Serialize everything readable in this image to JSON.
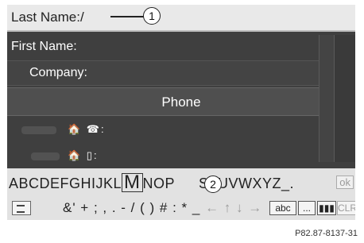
{
  "form": {
    "last_name_label": "Last Name:",
    "last_name_value": "/",
    "first_name_label": "First Name:",
    "company_label": "Company:",
    "phone_header": "Phone",
    "home_phone_icons": "🏠 ☎:",
    "home_mobile_icons": "🏠 ▯:"
  },
  "keyboard": {
    "letters_before": "ABCDEFGHIJKL",
    "selected_letter": "M",
    "letters_after": "NOP",
    "letters_rest": "STUVWXYZ_.",
    "ok_label": "ok",
    "symbols": "&' + ; , . - / ( ) # : * _",
    "arrows": "← ↑ ↓ →",
    "abc_label": "abc",
    "more_label": "...",
    "keys_label": "▮▮▮",
    "clr_label": "CLR"
  },
  "callouts": {
    "one": "1",
    "two": "2"
  },
  "figure_code": "P82.87-8137-31"
}
